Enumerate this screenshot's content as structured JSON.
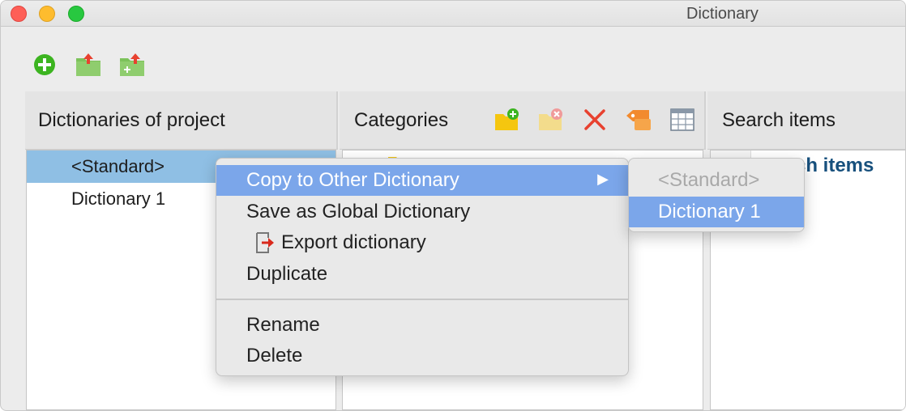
{
  "window": {
    "title": "Dictionary"
  },
  "toolbar": {
    "buttons": [
      {
        "icon": "add-icon"
      },
      {
        "icon": "import-folder-icon"
      },
      {
        "icon": "add-folder-icon"
      }
    ]
  },
  "panels": {
    "dictionaries": {
      "title": "Dictionaries of project",
      "items": [
        {
          "label": "<Standard>",
          "selected": true
        },
        {
          "label": "Dictionary 1",
          "selected": false
        }
      ]
    },
    "categories": {
      "title": "Categories",
      "icons": [
        "new-category-icon",
        "remove-category-icon",
        "delete-icon",
        "tag-icon",
        "table-icon"
      ]
    },
    "search": {
      "title": "Search items",
      "partial_text": "ch items"
    }
  },
  "context_menu": {
    "items": [
      {
        "label": "Copy to Other Dictionary",
        "highlighted": true,
        "has_submenu": true,
        "arrow": "▶"
      },
      {
        "label": "Save as Global Dictionary"
      },
      {
        "label": "Export dictionary",
        "icon": "export-icon"
      },
      {
        "label": "Duplicate"
      },
      {
        "label": "Rename"
      },
      {
        "label": "Delete"
      }
    ],
    "submenu": [
      {
        "label": "<Standard>",
        "disabled": true
      },
      {
        "label": "Dictionary 1",
        "highlighted": true
      }
    ]
  },
  "colors": {
    "selection": "#8fbfe4",
    "menu_highlight": "#7ba6ea",
    "search_link": "#17507d",
    "add_green": "#3cb420",
    "folder_green": "#7cc25a",
    "delete_red": "#e8412f",
    "folder_yellow": "#f5c60f"
  }
}
